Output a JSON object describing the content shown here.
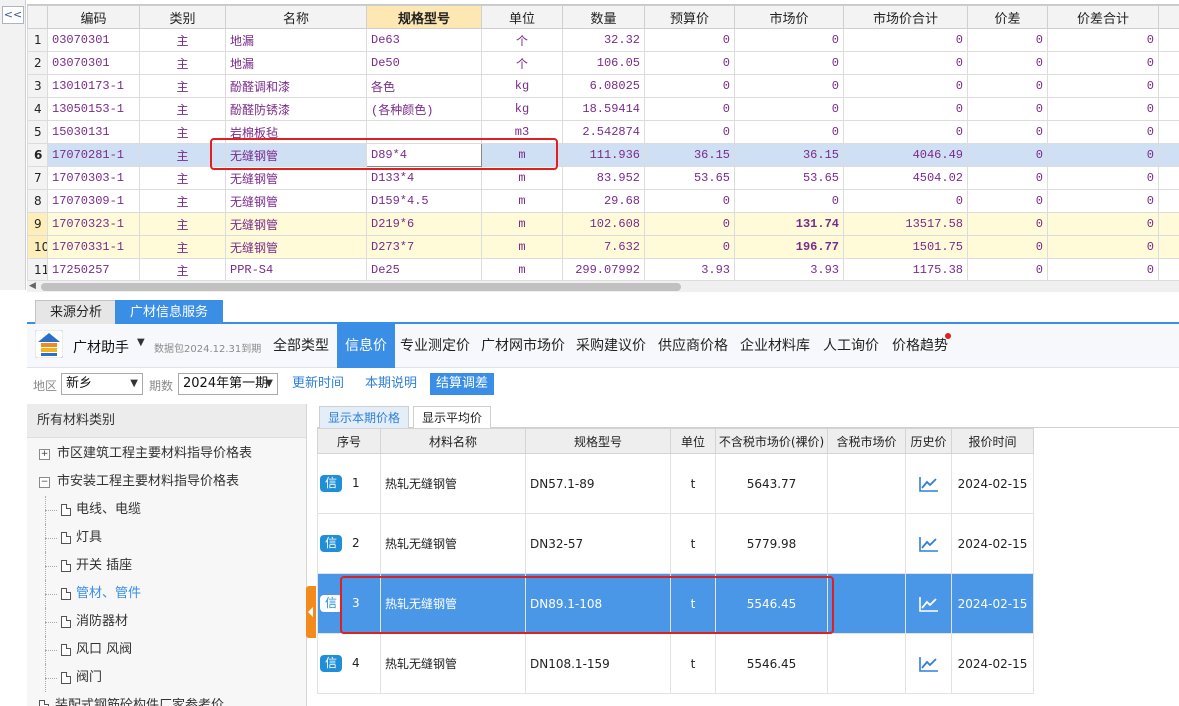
{
  "collapse_button": "<<",
  "grid": {
    "headers": [
      "编码",
      "类别",
      "名称",
      "规格型号",
      "单位",
      "数量",
      "预算价",
      "市场价",
      "市场价合计",
      "价差",
      "价差合计"
    ],
    "rows": [
      {
        "n": "1",
        "code": "03070301",
        "cat": "主",
        "name": "地漏",
        "spec": "De63",
        "unit": "个",
        "qty": "32.32",
        "budget": "0",
        "market": "0",
        "market_total": "0",
        "diff": "0",
        "diff_total": "0"
      },
      {
        "n": "2",
        "code": "03070301",
        "cat": "主",
        "name": "地漏",
        "spec": "De50",
        "unit": "个",
        "qty": "106.05",
        "budget": "0",
        "market": "0",
        "market_total": "0",
        "diff": "0",
        "diff_total": "0"
      },
      {
        "n": "3",
        "code": "13010173-1",
        "cat": "主",
        "name": "酚醛调和漆",
        "spec": "各色",
        "unit": "kg",
        "qty": "6.08025",
        "budget": "0",
        "market": "0",
        "market_total": "0",
        "diff": "0",
        "diff_total": "0"
      },
      {
        "n": "4",
        "code": "13050153-1",
        "cat": "主",
        "name": "酚醛防锈漆",
        "spec": "(各种颜色)",
        "unit": "kg",
        "qty": "18.59414",
        "budget": "0",
        "market": "0",
        "market_total": "0",
        "diff": "0",
        "diff_total": "0"
      },
      {
        "n": "5",
        "code": "15030131",
        "cat": "主",
        "name": "岩棉板毡",
        "spec": "",
        "unit": "m3",
        "qty": "2.542874",
        "budget": "0",
        "market": "0",
        "market_total": "0",
        "diff": "0",
        "diff_total": "0"
      },
      {
        "n": "6",
        "code": "17070281-1",
        "cat": "主",
        "name": "无缝钢管",
        "spec": "D89*4",
        "unit": "m",
        "qty": "111.936",
        "budget": "36.15",
        "market": "36.15",
        "market_total": "4046.49",
        "diff": "0",
        "diff_total": "0"
      },
      {
        "n": "7",
        "code": "17070303-1",
        "cat": "主",
        "name": "无缝钢管",
        "spec": "D133*4",
        "unit": "m",
        "qty": "83.952",
        "budget": "53.65",
        "market": "53.65",
        "market_total": "4504.02",
        "diff": "0",
        "diff_total": "0"
      },
      {
        "n": "8",
        "code": "17070309-1",
        "cat": "主",
        "name": "无缝钢管",
        "spec": "D159*4.5",
        "unit": "m",
        "qty": "29.68",
        "budget": "0",
        "market": "0",
        "market_total": "0",
        "diff": "0",
        "diff_total": "0"
      },
      {
        "n": "9",
        "code": "17070323-1",
        "cat": "主",
        "name": "无缝钢管",
        "spec": "D219*6",
        "unit": "m",
        "qty": "102.608",
        "budget": "0",
        "market": "131.74",
        "market_total": "13517.58",
        "diff": "0",
        "diff_total": "0"
      },
      {
        "n": "10",
        "code": "17070331-1",
        "cat": "主",
        "name": "无缝钢管",
        "spec": "D273*7",
        "unit": "m",
        "qty": "7.632",
        "budget": "0",
        "market": "196.77",
        "market_total": "1501.75",
        "diff": "0",
        "diff_total": "0"
      },
      {
        "n": "11",
        "code": "17250257",
        "cat": "主",
        "name": "PPR-S4",
        "spec": "De25",
        "unit": "m",
        "qty": "299.07992",
        "budget": "3.93",
        "market": "3.93",
        "market_total": "1175.38",
        "diff": "0",
        "diff_total": "0"
      }
    ]
  },
  "tabs": [
    "来源分析",
    "广材信息服务"
  ],
  "toolbar": {
    "assistant": "广材助手",
    "package_note": "数据包2024.12.31到期",
    "nav": [
      "全部类型",
      "信息价",
      "专业测定价",
      "广材网市场价",
      "采购建议价",
      "供应商价格",
      "企业材料库",
      "人工询价",
      "价格趋势"
    ]
  },
  "filter": {
    "region_label": "地区",
    "region_value": "新乡",
    "period_label": "期数",
    "period_value": "2024年第一期",
    "btn_update": "更新时间",
    "btn_notes": "本期说明",
    "btn_settle": "结算调差"
  },
  "sidebar": {
    "header": "所有材料类别",
    "items": [
      {
        "label": "市区建筑工程主要材料指导价格表",
        "type": "plus"
      },
      {
        "label": "市安装工程主要材料指导价格表",
        "type": "minus"
      },
      {
        "label": "电线、电缆",
        "type": "doc"
      },
      {
        "label": "灯具",
        "type": "doc"
      },
      {
        "label": "开关 插座",
        "type": "doc"
      },
      {
        "label": "管材、管件",
        "type": "doc"
      },
      {
        "label": "消防器材",
        "type": "doc"
      },
      {
        "label": "风口 风阀",
        "type": "doc"
      },
      {
        "label": "阀门",
        "type": "doc"
      },
      {
        "label": "装配式钢筋砼构件厂家参考价",
        "type": "doc-root"
      }
    ]
  },
  "subtabs": [
    "显示本期价格",
    "显示平均价"
  ],
  "price_table": {
    "headers": [
      "序号",
      "材料名称",
      "规格型号",
      "单位",
      "不含税市场价(裸价)",
      "含税市场价",
      "历史价",
      "报价时间"
    ],
    "badge": "信",
    "rows": [
      {
        "seq": "1",
        "name": "热轧无缝钢管",
        "spec": "DN57.1-89",
        "unit": "t",
        "price": "5643.77",
        "tax_price": "",
        "date": "2024-02-15"
      },
      {
        "seq": "2",
        "name": "热轧无缝钢管",
        "spec": "DN32-57",
        "unit": "t",
        "price": "5779.98",
        "tax_price": "",
        "date": "2024-02-15"
      },
      {
        "seq": "3",
        "name": "热轧无缝钢管",
        "spec": "DN89.1-108",
        "unit": "t",
        "price": "5546.45",
        "tax_price": "",
        "date": "2024-02-15"
      },
      {
        "seq": "4",
        "name": "热轧无缝钢管",
        "spec": "DN108.1-159",
        "unit": "t",
        "price": "5546.45",
        "tax_price": "",
        "date": "2024-02-15"
      }
    ]
  },
  "colors": {
    "accent": "#3a8ee6",
    "highlight_red": "#e02020",
    "code_purple": "#7a2a8a"
  }
}
